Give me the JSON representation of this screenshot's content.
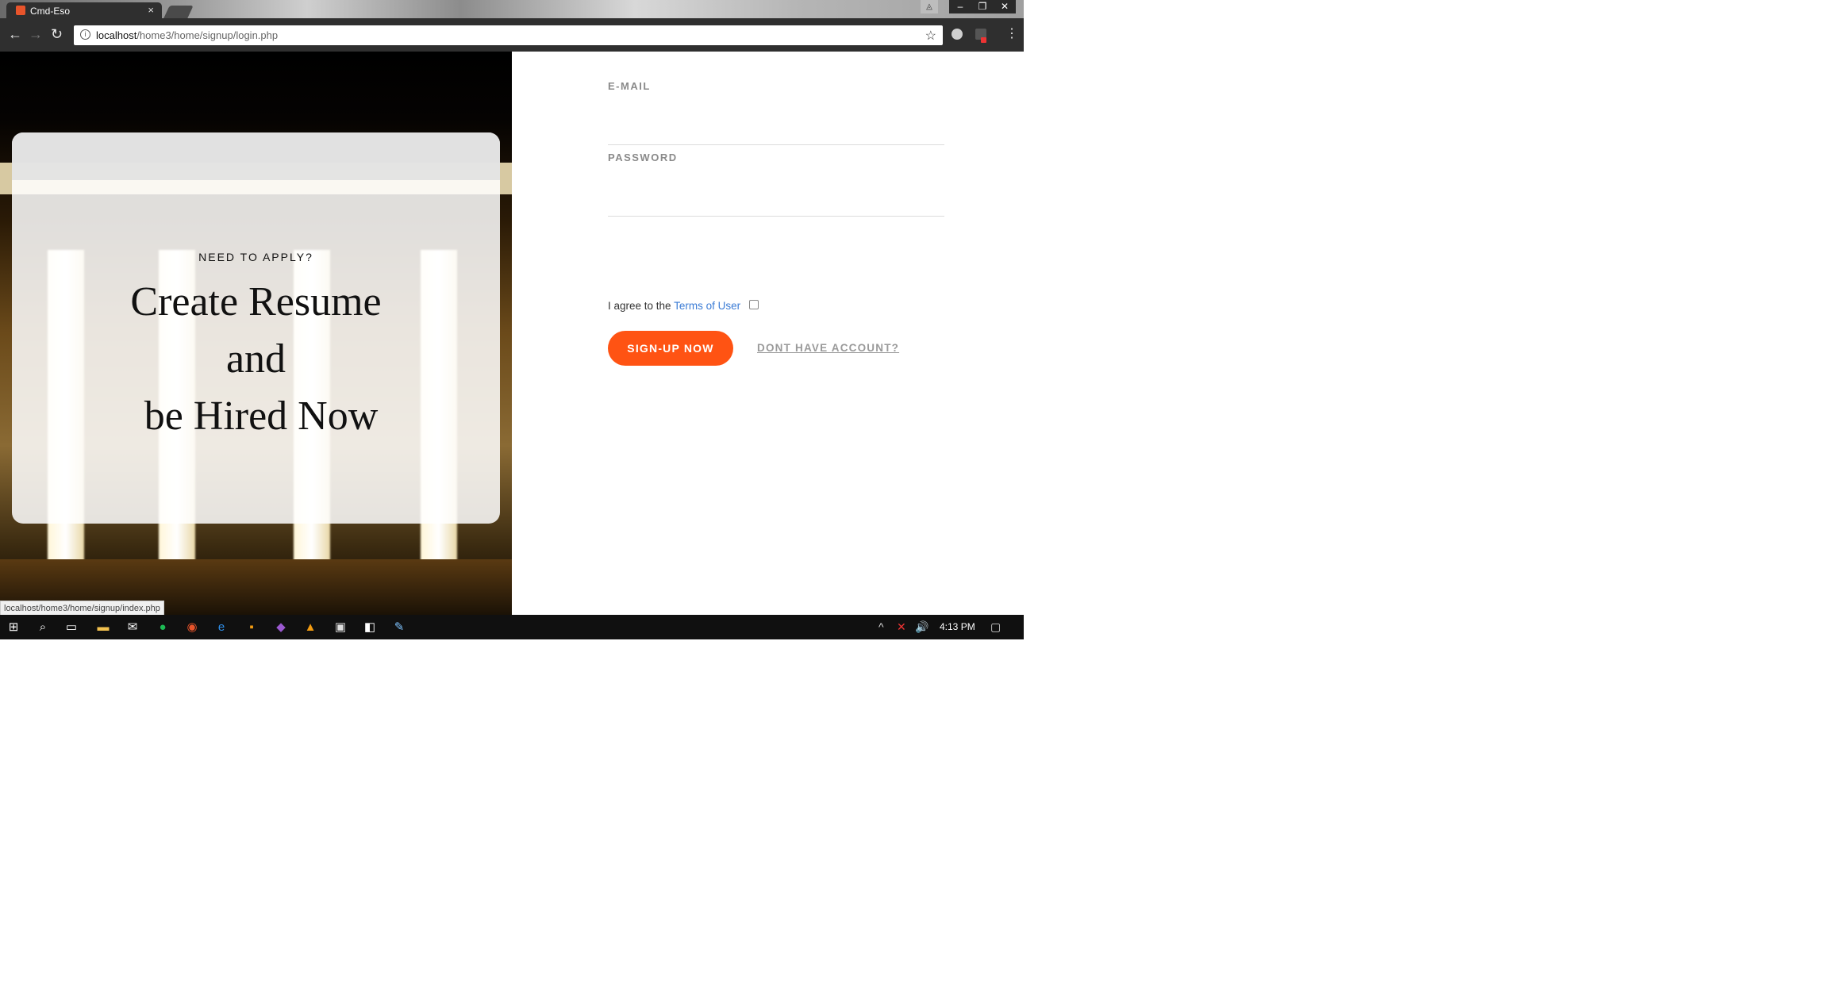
{
  "browser": {
    "tab_title": "Cmd-Eso",
    "tab_close": "×",
    "url_host": "localhost",
    "url_path": "/home3/home/signup/login.php",
    "status_url": "localhost/home3/home/signup/index.php",
    "icons": [
      "back-icon",
      "forward-icon",
      "reload-icon",
      "info-icon",
      "star-icon",
      "menu-icon"
    ]
  },
  "hero": {
    "tagline": "NEED TO APPLY?",
    "headline_lines": [
      "Create Resume",
      "and",
      " be Hired Now"
    ]
  },
  "form": {
    "email_label": "E-MAIL",
    "password_label": "PASSWORD",
    "agree_text": "I agree to the ",
    "terms_link": "Terms of User",
    "signup_button": "SIGN-UP NOW",
    "account_link": "DONT HAVE ACCOUNT?"
  },
  "colors": {
    "accent": "#ff5313",
    "link": "#3a7bd5"
  },
  "taskbar": {
    "clock": "4:13 PM",
    "apps": [
      "windows-start-icon",
      "search-icon",
      "task-view-icon",
      "file-explorer-icon",
      "mail-icon",
      "spotify-icon",
      "chrome-icon",
      "edge-icon",
      "sublime-icon",
      "visual-studio-icon",
      "vlc-icon",
      "store-icon",
      "app-icon",
      "paint-icon"
    ]
  }
}
